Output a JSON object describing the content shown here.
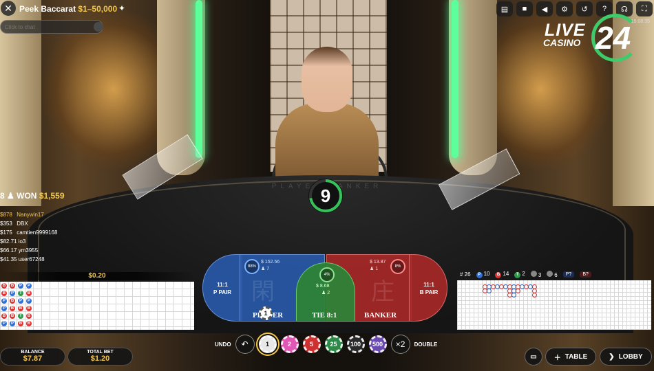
{
  "header": {
    "title": "Peek Baccarat",
    "limits": "$1–50,000",
    "chat_placeholder": "Click to chat",
    "clock": "15:08:35"
  },
  "brand": {
    "live": "LIVE",
    "casino": "CASINO",
    "number": "24"
  },
  "winners": {
    "count": "8",
    "won_label": "WON",
    "won_amount": "$1,559",
    "list": [
      {
        "amount": "$878",
        "name": "Nanywin17"
      },
      {
        "amount": "$353",
        "name": "DBX"
      },
      {
        "amount": "$175",
        "name": "camtien9999168"
      },
      {
        "amount": "$82.71",
        "name": "io3"
      },
      {
        "amount": "$66.17",
        "name": "ym3955"
      },
      {
        "amount": "$41.35",
        "name": "user67248"
      }
    ]
  },
  "timer": {
    "seconds": "9"
  },
  "table_print": "PLAYER  BANKER",
  "bets": {
    "player_pair_odds": "11:1",
    "player_pair_label": "P PAIR",
    "player_label": "PLAYER",
    "player_amount": "$ 152.56",
    "player_count": "7",
    "player_pct": "88%",
    "tie_label": "TIE",
    "tie_odds": "8:1",
    "tie_amount": "$ 8.68",
    "tie_count": "2",
    "tie_pct": "4%",
    "banker_label": "BANKER",
    "banker_amount": "$ 13.87",
    "banker_count": "1",
    "banker_pct": "8%",
    "banker_pair_odds": "11:1",
    "banker_pair_label": "B PAIR",
    "placed_chip": "1"
  },
  "roadmap": {
    "bet_total": "$0.20",
    "stats": {
      "rounds": "26",
      "player": "10",
      "banker": "14",
      "tie": "2",
      "player_pair": "3",
      "banker_pair": "6"
    },
    "predict_player": "P?",
    "predict_banker": "B?",
    "beads": [
      "B",
      "B",
      "P",
      "P",
      "B",
      "P",
      "B",
      "P",
      "B",
      "B",
      "B",
      "P",
      "P",
      "T",
      "P",
      "B",
      "T",
      "B",
      "P",
      "B",
      "P",
      "B",
      "B",
      "B"
    ]
  },
  "balance": {
    "label": "BALANCE",
    "value": "$7.87"
  },
  "total_bet": {
    "label": "TOTAL BET",
    "value": "$1.20"
  },
  "controls": {
    "undo": "UNDO",
    "double": "DOUBLE",
    "double_icon": "×2"
  },
  "chips": [
    {
      "value": "1",
      "color": "#e8e8e8"
    },
    {
      "value": "2",
      "color": "#e058b4"
    },
    {
      "value": "5",
      "color": "#d03030"
    },
    {
      "value": "25",
      "color": "#2f8a4a"
    },
    {
      "value": "100",
      "color": "#2a2a2a"
    },
    {
      "value": "500",
      "color": "#6b4bb0"
    }
  ],
  "nav": {
    "table": "TABLE",
    "lobby": "LOBBY"
  }
}
